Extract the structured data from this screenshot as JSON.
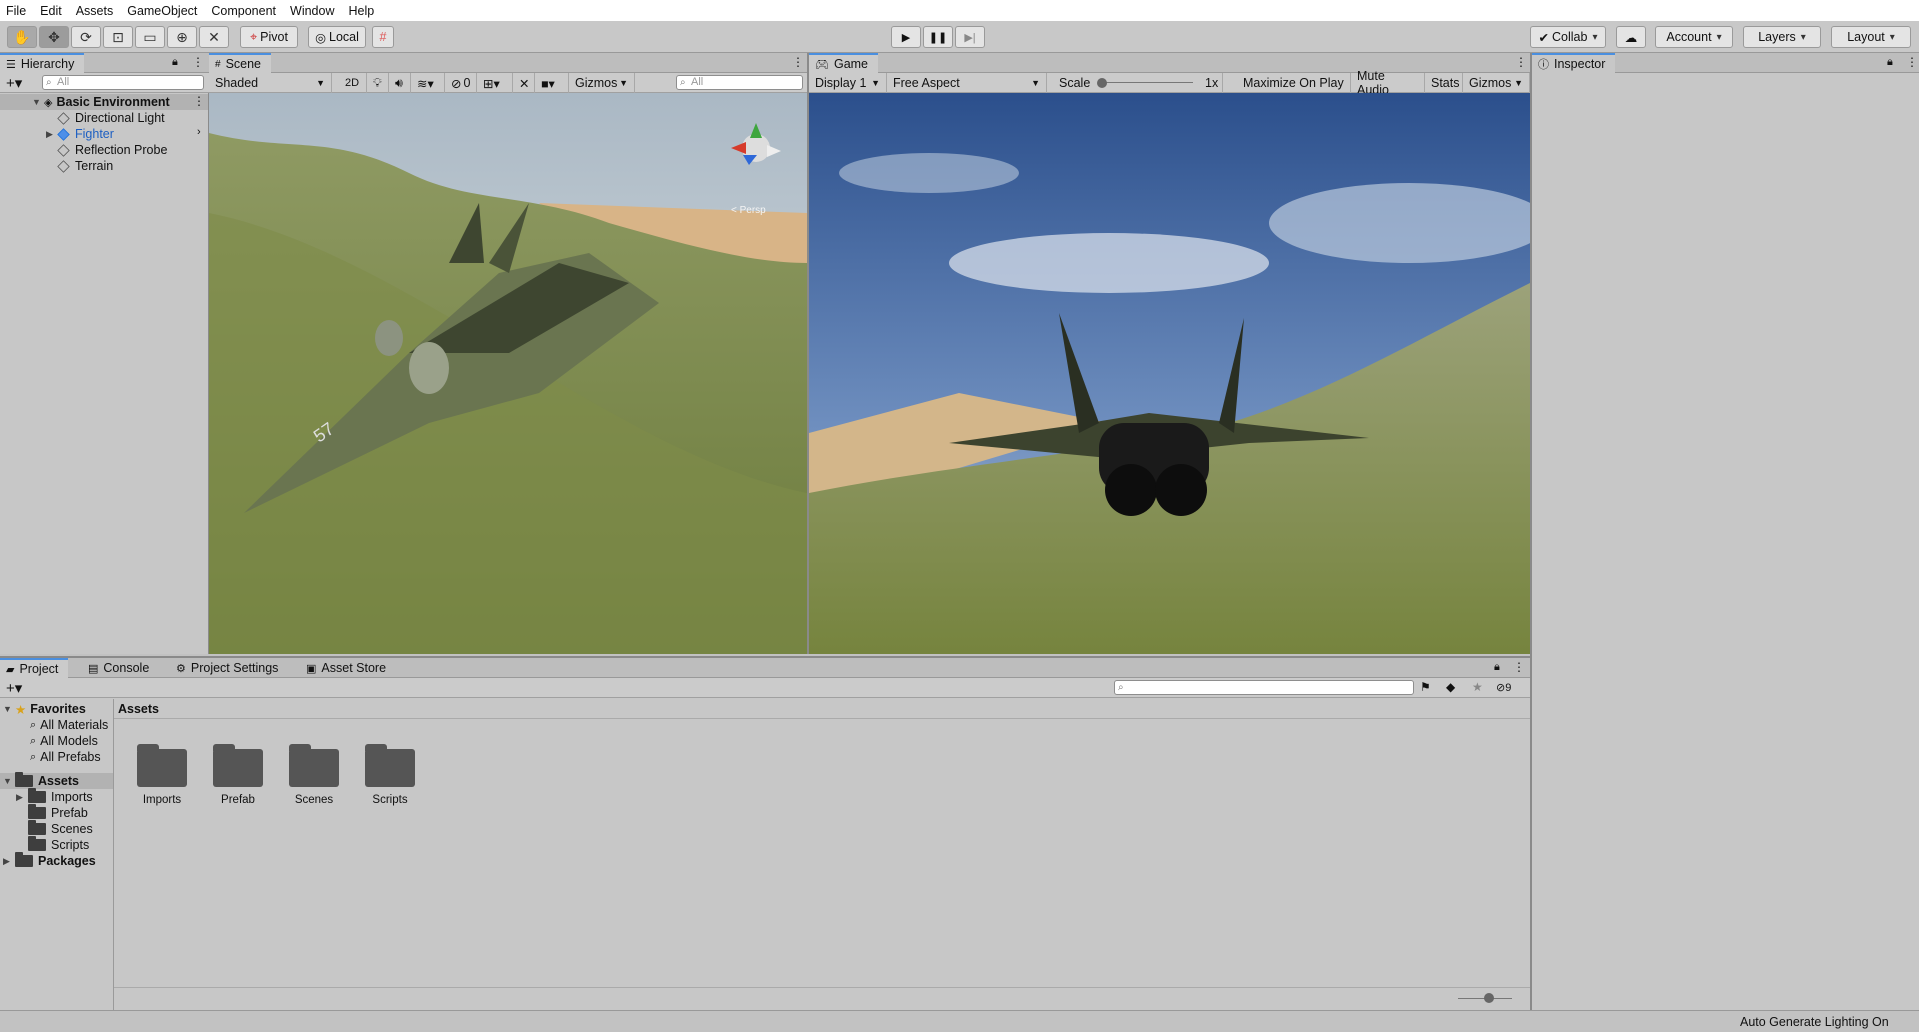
{
  "menu": [
    "File",
    "Edit",
    "Assets",
    "GameObject",
    "Component",
    "Window",
    "Help"
  ],
  "toolbar": {
    "pivot": "Pivot",
    "local": "Local",
    "collab": "Collab",
    "account": "Account",
    "layers": "Layers",
    "layout": "Layout"
  },
  "hierarchy": {
    "tab": "Hierarchy",
    "search_placeholder": "All",
    "scene": "Basic Environment",
    "items": [
      "Directional Light",
      "Fighter",
      "Reflection Probe",
      "Terrain"
    ]
  },
  "scene_view": {
    "tab": "Scene",
    "shading": "Shaded",
    "mode_2d": "2D",
    "hidden_count": "0",
    "gizmos": "Gizmos",
    "search_placeholder": "All",
    "persp_label": "< Persp",
    "fighter_number": "57"
  },
  "game_view": {
    "tab": "Game",
    "display": "Display 1",
    "aspect": "Free Aspect",
    "scale_label": "Scale",
    "scale_value": "1x",
    "maximize": "Maximize On Play",
    "mute": "Mute Audio",
    "stats": "Stats",
    "gizmos": "Gizmos"
  },
  "inspector": {
    "tab": "Inspector"
  },
  "project": {
    "tabs": [
      "Project",
      "Console",
      "Project Settings",
      "Asset Store"
    ],
    "hidden_count": "9",
    "favorites_label": "Favorites",
    "favorites": [
      "All Materials",
      "All Models",
      "All Prefabs"
    ],
    "assets_label": "Assets",
    "asset_folders": [
      "Imports",
      "Prefab",
      "Scenes",
      "Scripts"
    ],
    "packages_label": "Packages",
    "breadcrumb": "Assets",
    "grid_folders": [
      "Imports",
      "Prefab",
      "Scenes",
      "Scripts"
    ]
  },
  "status": {
    "text": "Auto Generate Lighting On"
  }
}
